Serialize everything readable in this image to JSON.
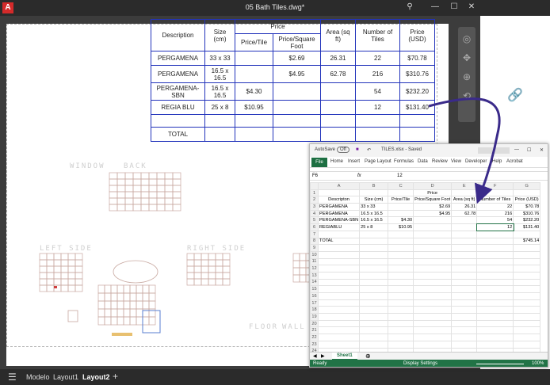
{
  "acad": {
    "logo": "A",
    "title": "05 Bath Tiles.dwg*",
    "tabs": [
      "Modelo",
      "Layout1",
      "Layout2"
    ],
    "add_tab": "+",
    "menu": "☰"
  },
  "cad_table": {
    "headers": {
      "description": "Description",
      "size": "Size (cm)",
      "price": "Price",
      "price_tile": "Price/Tile",
      "price_sqft": "Price/Square Foot",
      "area": "Area (sq ft)",
      "num_tiles": "Number of Tiles",
      "price_usd": "Price (USD)"
    },
    "rows": [
      {
        "desc": "PERGAMENA",
        "size": "33 x 33",
        "tile": "",
        "sqft": "$2.69",
        "area": "26.31",
        "num": "22",
        "usd": "$70.78"
      },
      {
        "desc": "PERGAMENA",
        "size": "16.5 x 16.5",
        "tile": "",
        "sqft": "$4.95",
        "area": "62.78",
        "num": "216",
        "usd": "$310.76"
      },
      {
        "desc": "PERGAMENA-SBN",
        "size": "16.5 x 16.5",
        "tile": "$4.30",
        "sqft": "",
        "area": "",
        "num": "54",
        "usd": "$232.20"
      },
      {
        "desc": "REGIA BLU",
        "size": "25 x 8",
        "tile": "$10.95",
        "sqft": "",
        "area": "",
        "num": "12",
        "usd": "$131.40"
      }
    ],
    "total_label": "TOTAL"
  },
  "drawing_labels": {
    "window": "WINDOW",
    "back": "BACK",
    "left_side": "LEFT SIDE",
    "right_side": "RIGHT SIDE",
    "floor": "FLOOR",
    "wall": "WALL"
  },
  "excel": {
    "autosave": "AutoSave",
    "autosave_state": "Off",
    "title": "TILES.xlsx - Saved",
    "ribbon": [
      "File",
      "Home",
      "Insert",
      "Page Layout",
      "Formulas",
      "Data",
      "Review",
      "View",
      "Developer",
      "Help",
      "Acrobat"
    ],
    "name_box": "F6",
    "formula_value": "12",
    "fx": "fx",
    "columns": [
      "A",
      "B",
      "C",
      "D",
      "E",
      "F",
      "G"
    ],
    "rows": [
      {
        "n": "1",
        "cells": [
          "",
          "",
          "",
          "Price",
          "",
          "",
          ""
        ]
      },
      {
        "n": "2",
        "cells": [
          "Descripton",
          "Size (cm)",
          "Price/Tile",
          "Price/Square Foot",
          "Area (sq ft)",
          "Number of Tiles",
          "Price (USD)"
        ]
      },
      {
        "n": "3",
        "cells": [
          "PERGAMENA",
          "33 x 33",
          "",
          "$2.69",
          "26.31",
          "22",
          "$70.78"
        ]
      },
      {
        "n": "4",
        "cells": [
          "PERGAMENA",
          "16.5 x 16.5",
          "",
          "$4.95",
          "62.78",
          "216",
          "$310.76"
        ]
      },
      {
        "n": "5",
        "cells": [
          "PERGAMENA-SBN",
          "16.5 x 16.5",
          "$4.30",
          "",
          "",
          "54",
          "$232.20"
        ]
      },
      {
        "n": "6",
        "cells": [
          "REGIABLU",
          "25 x 8",
          "$10.95",
          "",
          "",
          "12",
          "$131.40"
        ]
      },
      {
        "n": "7",
        "cells": [
          "",
          "",
          "",
          "",
          "",
          "",
          ""
        ]
      },
      {
        "n": "8",
        "cells": [
          "TOTAL",
          "",
          "",
          "",
          "",
          "",
          "$745.14"
        ]
      },
      {
        "n": "9",
        "cells": [
          "",
          "",
          "",
          "",
          "",
          "",
          ""
        ]
      },
      {
        "n": "10",
        "cells": [
          "",
          "",
          "",
          "",
          "",
          "",
          ""
        ]
      },
      {
        "n": "11",
        "cells": [
          "",
          "",
          "",
          "",
          "",
          "",
          ""
        ]
      },
      {
        "n": "12",
        "cells": [
          "",
          "",
          "",
          "",
          "",
          "",
          ""
        ]
      },
      {
        "n": "13",
        "cells": [
          "",
          "",
          "",
          "",
          "",
          "",
          ""
        ]
      },
      {
        "n": "14",
        "cells": [
          "",
          "",
          "",
          "",
          "",
          "",
          ""
        ]
      },
      {
        "n": "15",
        "cells": [
          "",
          "",
          "",
          "",
          "",
          "",
          ""
        ]
      },
      {
        "n": "16",
        "cells": [
          "",
          "",
          "",
          "",
          "",
          "",
          ""
        ]
      },
      {
        "n": "17",
        "cells": [
          "",
          "",
          "",
          "",
          "",
          "",
          ""
        ]
      },
      {
        "n": "18",
        "cells": [
          "",
          "",
          "",
          "",
          "",
          "",
          ""
        ]
      },
      {
        "n": "19",
        "cells": [
          "",
          "",
          "",
          "",
          "",
          "",
          ""
        ]
      },
      {
        "n": "20",
        "cells": [
          "",
          "",
          "",
          "",
          "",
          "",
          ""
        ]
      },
      {
        "n": "21",
        "cells": [
          "",
          "",
          "",
          "",
          "",
          "",
          ""
        ]
      },
      {
        "n": "22",
        "cells": [
          "",
          "",
          "",
          "",
          "",
          "",
          ""
        ]
      },
      {
        "n": "23",
        "cells": [
          "",
          "",
          "",
          "",
          "",
          "",
          ""
        ]
      },
      {
        "n": "24",
        "cells": [
          "",
          "",
          "",
          "",
          "",
          "",
          ""
        ]
      }
    ],
    "sheet_tab": "Sheet1",
    "status_ready": "Ready",
    "display_settings": "Display Settings",
    "zoom": "100%"
  },
  "colors": {
    "cad_table_line": "#2233bb",
    "excel_green": "#217346",
    "arrow": "#3a2a8a"
  }
}
